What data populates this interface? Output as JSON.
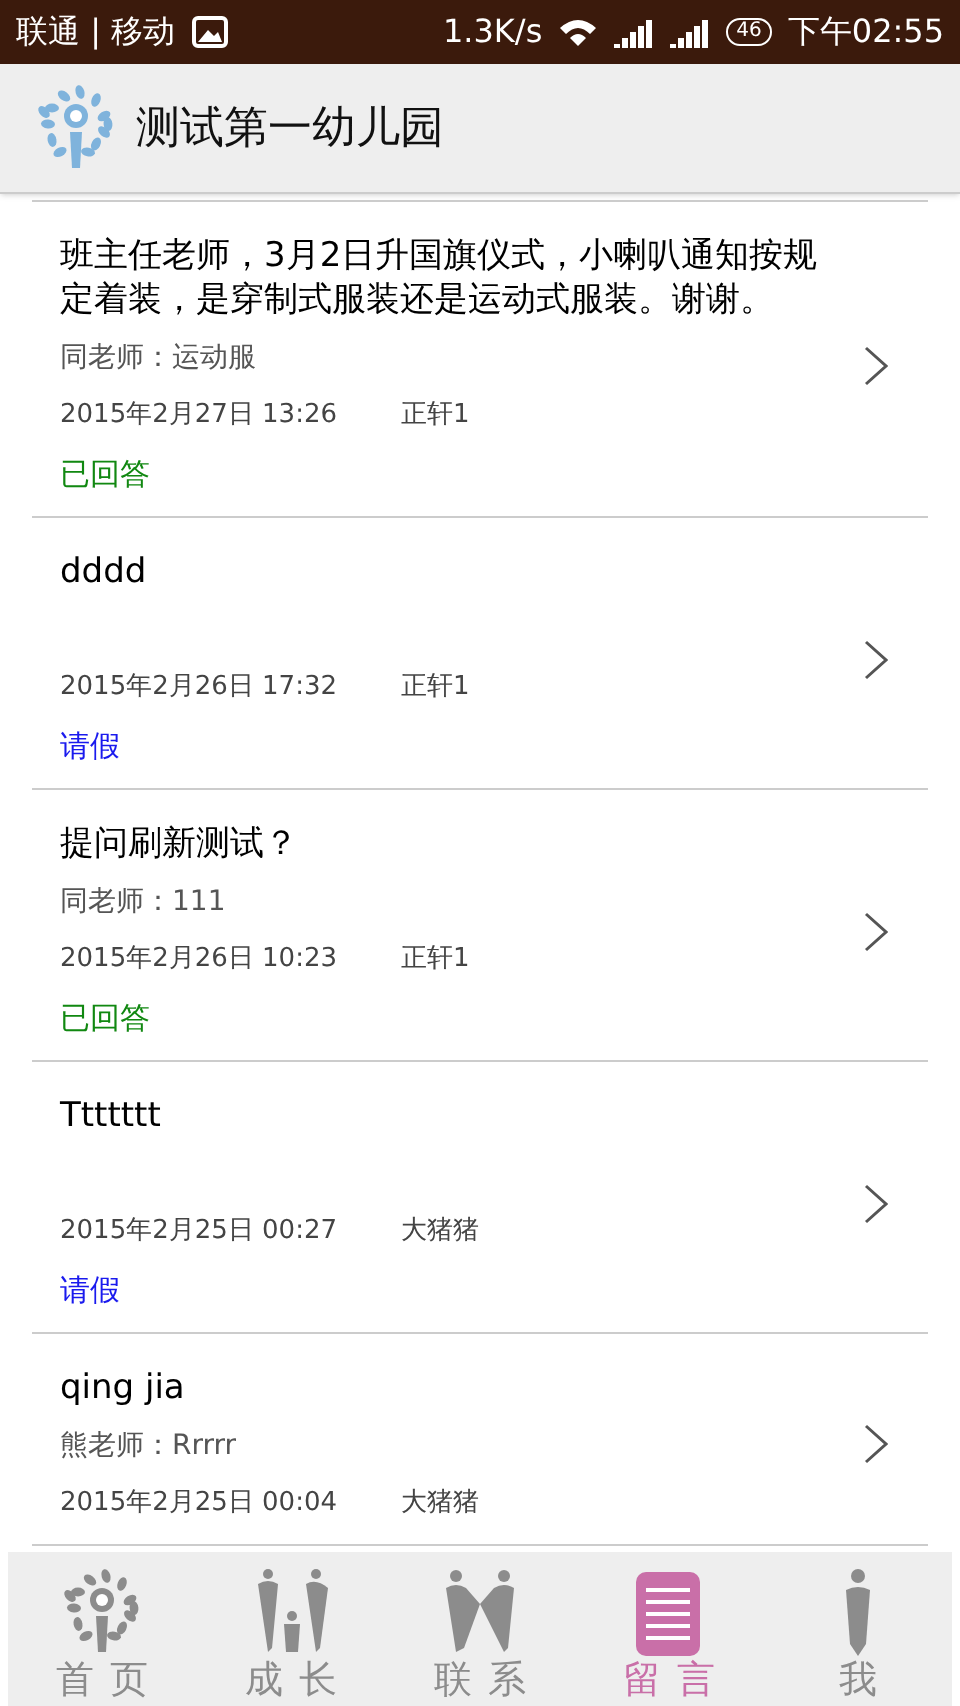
{
  "status_bar": {
    "carrier": "联通 | 移动",
    "speed": "1.3K/s",
    "battery": "46",
    "time": "下午02:55"
  },
  "header": {
    "title": "测试第一幼儿园"
  },
  "messages": [
    {
      "question": "班主任老师，3月2日升国旗仪式，小喇叭通知按规定着装，是穿制式服装还是运动式服装。谢谢。",
      "reply": "同老师：运动服",
      "date": "2015年2月27日 13:26",
      "author": "正轩1",
      "status": {
        "kind": "answered",
        "label": "已回答"
      }
    },
    {
      "question": "dddd",
      "date": "2015年2月26日 17:32",
      "author": "正轩1",
      "status": {
        "kind": "leave",
        "label": "请假"
      }
    },
    {
      "question": "提问刷新测试？",
      "reply": "同老师：111",
      "date": "2015年2月26日 10:23",
      "author": "正轩1",
      "status": {
        "kind": "answered",
        "label": "已回答"
      }
    },
    {
      "question": "Ttttttt",
      "date": "2015年2月25日 00:27",
      "author": "大猪猪",
      "status": {
        "kind": "leave",
        "label": "请假"
      }
    },
    {
      "question": "qing jia",
      "reply": "熊老师：Rrrrr",
      "date": "2015年2月25日 00:04",
      "author": "大猪猪"
    }
  ],
  "tabs": [
    {
      "kind": "home",
      "label": "首页",
      "selected": false
    },
    {
      "kind": "growth",
      "label": "成长",
      "selected": false
    },
    {
      "kind": "contact",
      "label": "联系",
      "selected": false
    },
    {
      "kind": "message",
      "label": "留言",
      "selected": true
    },
    {
      "kind": "me",
      "label": "我",
      "selected": false
    }
  ]
}
